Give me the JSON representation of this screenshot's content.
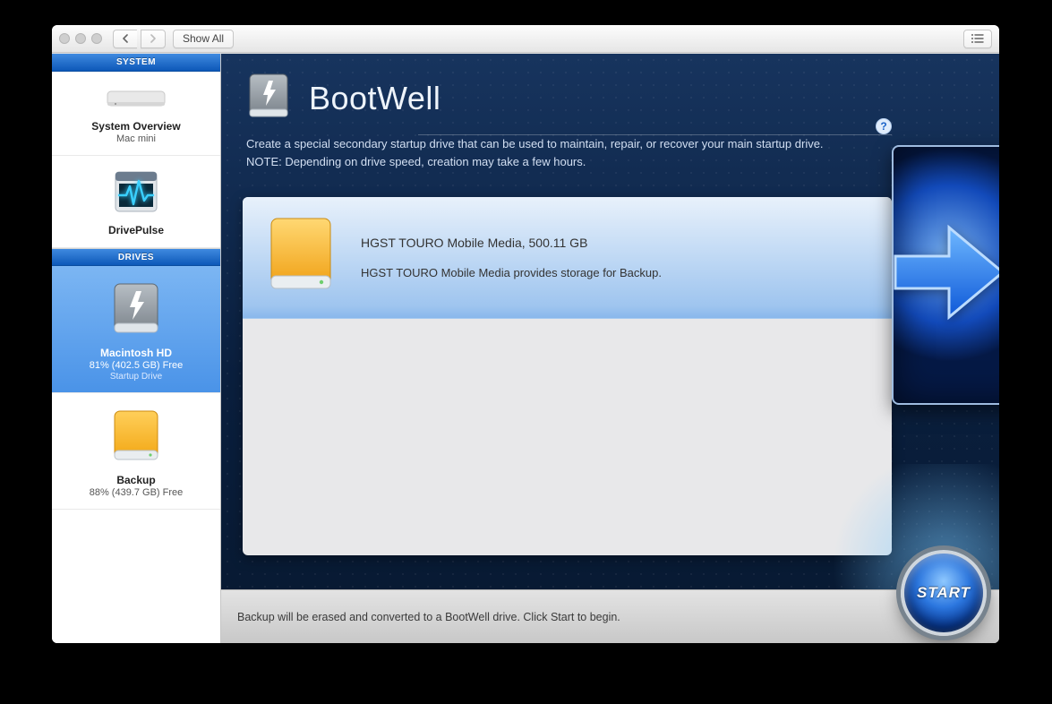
{
  "titlebar": {
    "show_all": "Show All"
  },
  "sidebar": {
    "system_header": "SYSTEM",
    "drives_header": "DRIVES",
    "overview": {
      "title": "System Overview",
      "sub": "Mac mini"
    },
    "drivepulse": {
      "title": "DrivePulse"
    },
    "drive0": {
      "title": "Macintosh HD",
      "sub": "81% (402.5 GB) Free",
      "sub2": "Startup Drive"
    },
    "drive1": {
      "title": "Backup",
      "sub": "88% (439.7 GB) Free"
    }
  },
  "hero": {
    "title": "BootWell",
    "desc": "Create a special secondary startup drive that can be used to maintain, repair, or recover your main startup drive. NOTE: Depending on drive speed, creation may take a few hours.",
    "help": "?"
  },
  "drive_panel": {
    "name": "HGST TOURO Mobile Media, 500.11 GB",
    "detail": "HGST TOURO Mobile Media provides storage for Backup."
  },
  "footer": {
    "status": "Backup will be erased and converted to a BootWell drive. Click Start to begin.",
    "start": "START"
  }
}
